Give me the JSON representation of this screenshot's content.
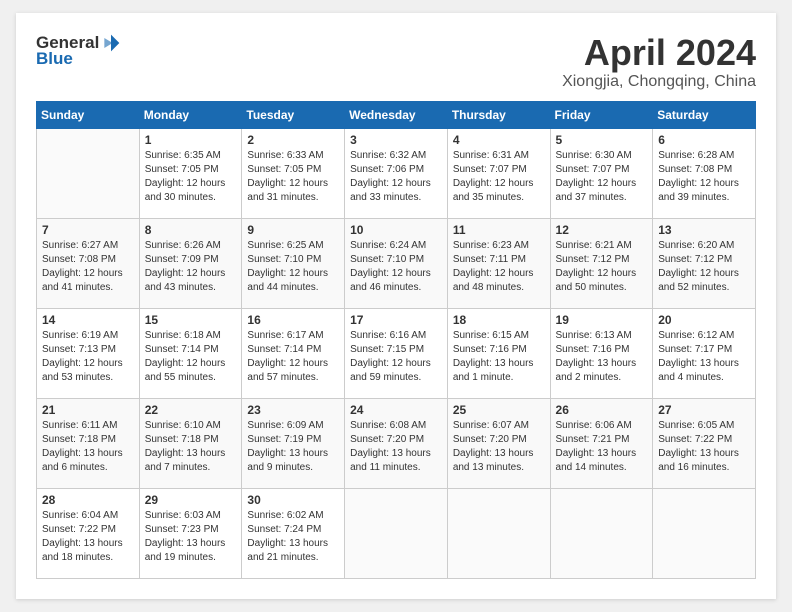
{
  "header": {
    "logo": {
      "text_general": "General",
      "text_blue": "Blue"
    },
    "title": "April 2024",
    "subtitle": "Xiongjia, Chongqing, China"
  },
  "weekdays": [
    "Sunday",
    "Monday",
    "Tuesday",
    "Wednesday",
    "Thursday",
    "Friday",
    "Saturday"
  ],
  "weeks": [
    [
      {
        "day": "",
        "sunrise": "",
        "sunset": "",
        "daylight": ""
      },
      {
        "day": "1",
        "sunrise": "Sunrise: 6:35 AM",
        "sunset": "Sunset: 7:05 PM",
        "daylight": "Daylight: 12 hours and 30 minutes."
      },
      {
        "day": "2",
        "sunrise": "Sunrise: 6:33 AM",
        "sunset": "Sunset: 7:05 PM",
        "daylight": "Daylight: 12 hours and 31 minutes."
      },
      {
        "day": "3",
        "sunrise": "Sunrise: 6:32 AM",
        "sunset": "Sunset: 7:06 PM",
        "daylight": "Daylight: 12 hours and 33 minutes."
      },
      {
        "day": "4",
        "sunrise": "Sunrise: 6:31 AM",
        "sunset": "Sunset: 7:07 PM",
        "daylight": "Daylight: 12 hours and 35 minutes."
      },
      {
        "day": "5",
        "sunrise": "Sunrise: 6:30 AM",
        "sunset": "Sunset: 7:07 PM",
        "daylight": "Daylight: 12 hours and 37 minutes."
      },
      {
        "day": "6",
        "sunrise": "Sunrise: 6:28 AM",
        "sunset": "Sunset: 7:08 PM",
        "daylight": "Daylight: 12 hours and 39 minutes."
      }
    ],
    [
      {
        "day": "7",
        "sunrise": "Sunrise: 6:27 AM",
        "sunset": "Sunset: 7:08 PM",
        "daylight": "Daylight: 12 hours and 41 minutes."
      },
      {
        "day": "8",
        "sunrise": "Sunrise: 6:26 AM",
        "sunset": "Sunset: 7:09 PM",
        "daylight": "Daylight: 12 hours and 43 minutes."
      },
      {
        "day": "9",
        "sunrise": "Sunrise: 6:25 AM",
        "sunset": "Sunset: 7:10 PM",
        "daylight": "Daylight: 12 hours and 44 minutes."
      },
      {
        "day": "10",
        "sunrise": "Sunrise: 6:24 AM",
        "sunset": "Sunset: 7:10 PM",
        "daylight": "Daylight: 12 hours and 46 minutes."
      },
      {
        "day": "11",
        "sunrise": "Sunrise: 6:23 AM",
        "sunset": "Sunset: 7:11 PM",
        "daylight": "Daylight: 12 hours and 48 minutes."
      },
      {
        "day": "12",
        "sunrise": "Sunrise: 6:21 AM",
        "sunset": "Sunset: 7:12 PM",
        "daylight": "Daylight: 12 hours and 50 minutes."
      },
      {
        "day": "13",
        "sunrise": "Sunrise: 6:20 AM",
        "sunset": "Sunset: 7:12 PM",
        "daylight": "Daylight: 12 hours and 52 minutes."
      }
    ],
    [
      {
        "day": "14",
        "sunrise": "Sunrise: 6:19 AM",
        "sunset": "Sunset: 7:13 PM",
        "daylight": "Daylight: 12 hours and 53 minutes."
      },
      {
        "day": "15",
        "sunrise": "Sunrise: 6:18 AM",
        "sunset": "Sunset: 7:14 PM",
        "daylight": "Daylight: 12 hours and 55 minutes."
      },
      {
        "day": "16",
        "sunrise": "Sunrise: 6:17 AM",
        "sunset": "Sunset: 7:14 PM",
        "daylight": "Daylight: 12 hours and 57 minutes."
      },
      {
        "day": "17",
        "sunrise": "Sunrise: 6:16 AM",
        "sunset": "Sunset: 7:15 PM",
        "daylight": "Daylight: 12 hours and 59 minutes."
      },
      {
        "day": "18",
        "sunrise": "Sunrise: 6:15 AM",
        "sunset": "Sunset: 7:16 PM",
        "daylight": "Daylight: 13 hours and 1 minute."
      },
      {
        "day": "19",
        "sunrise": "Sunrise: 6:13 AM",
        "sunset": "Sunset: 7:16 PM",
        "daylight": "Daylight: 13 hours and 2 minutes."
      },
      {
        "day": "20",
        "sunrise": "Sunrise: 6:12 AM",
        "sunset": "Sunset: 7:17 PM",
        "daylight": "Daylight: 13 hours and 4 minutes."
      }
    ],
    [
      {
        "day": "21",
        "sunrise": "Sunrise: 6:11 AM",
        "sunset": "Sunset: 7:18 PM",
        "daylight": "Daylight: 13 hours and 6 minutes."
      },
      {
        "day": "22",
        "sunrise": "Sunrise: 6:10 AM",
        "sunset": "Sunset: 7:18 PM",
        "daylight": "Daylight: 13 hours and 7 minutes."
      },
      {
        "day": "23",
        "sunrise": "Sunrise: 6:09 AM",
        "sunset": "Sunset: 7:19 PM",
        "daylight": "Daylight: 13 hours and 9 minutes."
      },
      {
        "day": "24",
        "sunrise": "Sunrise: 6:08 AM",
        "sunset": "Sunset: 7:20 PM",
        "daylight": "Daylight: 13 hours and 11 minutes."
      },
      {
        "day": "25",
        "sunrise": "Sunrise: 6:07 AM",
        "sunset": "Sunset: 7:20 PM",
        "daylight": "Daylight: 13 hours and 13 minutes."
      },
      {
        "day": "26",
        "sunrise": "Sunrise: 6:06 AM",
        "sunset": "Sunset: 7:21 PM",
        "daylight": "Daylight: 13 hours and 14 minutes."
      },
      {
        "day": "27",
        "sunrise": "Sunrise: 6:05 AM",
        "sunset": "Sunset: 7:22 PM",
        "daylight": "Daylight: 13 hours and 16 minutes."
      }
    ],
    [
      {
        "day": "28",
        "sunrise": "Sunrise: 6:04 AM",
        "sunset": "Sunset: 7:22 PM",
        "daylight": "Daylight: 13 hours and 18 minutes."
      },
      {
        "day": "29",
        "sunrise": "Sunrise: 6:03 AM",
        "sunset": "Sunset: 7:23 PM",
        "daylight": "Daylight: 13 hours and 19 minutes."
      },
      {
        "day": "30",
        "sunrise": "Sunrise: 6:02 AM",
        "sunset": "Sunset: 7:24 PM",
        "daylight": "Daylight: 13 hours and 21 minutes."
      },
      {
        "day": "",
        "sunrise": "",
        "sunset": "",
        "daylight": ""
      },
      {
        "day": "",
        "sunrise": "",
        "sunset": "",
        "daylight": ""
      },
      {
        "day": "",
        "sunrise": "",
        "sunset": "",
        "daylight": ""
      },
      {
        "day": "",
        "sunrise": "",
        "sunset": "",
        "daylight": ""
      }
    ]
  ]
}
